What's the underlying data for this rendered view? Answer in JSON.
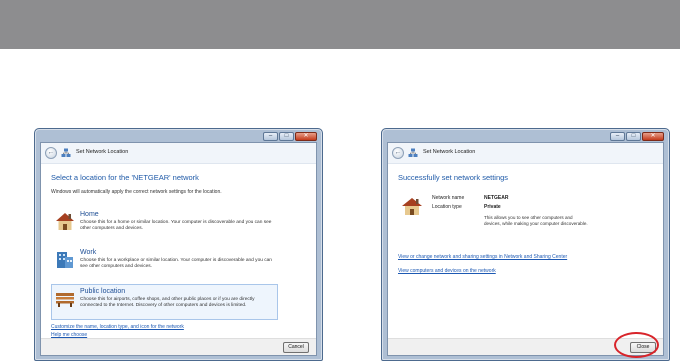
{
  "left_window": {
    "title": "Set Network Location",
    "heading": "Select a location for the 'NETGEAR' network",
    "subtext": "Windows will automatically apply the correct network settings for the location.",
    "options": [
      {
        "label": "Home",
        "description": "Choose this for a home or similar location. Your computer is discoverable and you can see other computers and devices.",
        "icon": "house-icon"
      },
      {
        "label": "Work",
        "description": "Choose this for a workplace or similar location. Your computer is discoverable and you can see other computers and devices.",
        "icon": "office-building-icon"
      },
      {
        "label": "Public location",
        "description": "Choose this for airports, coffee shops, and other public places or if you are directly connected to the Internet. Discovery of other computers and devices is limited.",
        "icon": "park-bench-icon"
      }
    ],
    "selected_option": "Public location",
    "link_customize": "Customize the name, location type, and icon for the network",
    "link_help": "Help me choose",
    "cancel_label": "Cancel"
  },
  "right_window": {
    "title": "Set Network Location",
    "heading": "Successfully set network settings",
    "network_name_label": "Network name",
    "network_name_value": "NETGEAR",
    "location_type_label": "Location type",
    "location_type_value": "Private",
    "note": "This allows you to see other computers and devices, while making your computer discoverable.",
    "link_sharing": "View or change network and sharing settings in Network and Sharing Center",
    "link_devices": "View computers and devices on the network",
    "close_label": "Close"
  },
  "colors": {
    "top_band": "#8d8d8f",
    "heading_blue": "#1f5aa8",
    "link_blue": "#1d59b3",
    "highlight_red": "#d8242a"
  }
}
